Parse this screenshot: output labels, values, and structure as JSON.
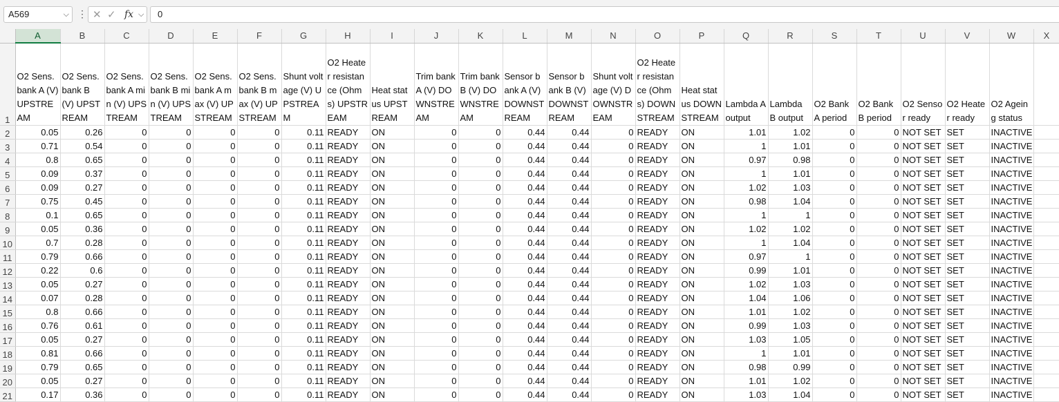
{
  "formula_bar": {
    "name_box": "A569",
    "chevron": "⌵",
    "more": "⋮",
    "cancel_icon": "✕",
    "enter_icon": "✓",
    "fx": "fx",
    "fx_chevron": "⌵",
    "value": "0"
  },
  "columns": [
    "A",
    "B",
    "C",
    "D",
    "E",
    "F",
    "G",
    "H",
    "I",
    "J",
    "K",
    "L",
    "M",
    "N",
    "O",
    "P",
    "Q",
    "R",
    "S",
    "T",
    "U",
    "V",
    "W",
    "X"
  ],
  "row_numbers": [
    1,
    2,
    3,
    4,
    5,
    6,
    7,
    8,
    9,
    10,
    11,
    12,
    13,
    14,
    15,
    16,
    17,
    18,
    19,
    20,
    21
  ],
  "header_row": [
    "O2 Sens.bank A (V) UPSTREAM",
    "O2 Sens.bank B (V) UPSTREAM",
    "O2 Sens.bank A min (V) UPSTREAM",
    "O2 Sens.bank B min (V) UPSTREAM",
    "O2 Sens.bank A max (V) UPSTREAM",
    "O2 Sens.bank B max (V) UPSTREAM",
    "Shunt voltage (V) UPSTREAM",
    "O2 Heater resistance (Ohms) UPSTREAM",
    "Heat status UPSTREAM",
    "Trim bank A (V) DOWNSTREAM",
    "Trim bank B (V) DOWNSTREAM",
    "Sensor bank A (V) DOWNSTREAM",
    "Sensor bank B (V) DOWNSTREAM",
    "Shunt voltage (V) DOWNSTREAM",
    "O2 Heater resistance (Ohms) DOWNSTREAM",
    "Heat status DOWNSTREAM",
    "Lambda A output",
    "Lambda B output",
    "O2 Bank A period",
    "O2 Bank B period",
    "O2 Sensor ready",
    "O2 Heater ready",
    "O2 Ageing status",
    ""
  ],
  "rows": [
    [
      "0.05",
      "0.26",
      "0",
      "0",
      "0",
      "0",
      "0.11",
      "READY",
      "ON",
      "0",
      "0",
      "0.44",
      "0.44",
      "0",
      "READY",
      "ON",
      "1.01",
      "1.02",
      "0",
      "0",
      "NOT SET",
      "SET",
      "INACTIVE",
      ""
    ],
    [
      "0.71",
      "0.54",
      "0",
      "0",
      "0",
      "0",
      "0.11",
      "READY",
      "ON",
      "0",
      "0",
      "0.44",
      "0.44",
      "0",
      "READY",
      "ON",
      "1",
      "1.01",
      "0",
      "0",
      "NOT SET",
      "SET",
      "INACTIVE",
      ""
    ],
    [
      "0.8",
      "0.65",
      "0",
      "0",
      "0",
      "0",
      "0.11",
      "READY",
      "ON",
      "0",
      "0",
      "0.44",
      "0.44",
      "0",
      "READY",
      "ON",
      "0.97",
      "0.98",
      "0",
      "0",
      "NOT SET",
      "SET",
      "INACTIVE",
      ""
    ],
    [
      "0.09",
      "0.37",
      "0",
      "0",
      "0",
      "0",
      "0.11",
      "READY",
      "ON",
      "0",
      "0",
      "0.44",
      "0.44",
      "0",
      "READY",
      "ON",
      "1",
      "1.01",
      "0",
      "0",
      "NOT SET",
      "SET",
      "INACTIVE",
      ""
    ],
    [
      "0.09",
      "0.27",
      "0",
      "0",
      "0",
      "0",
      "0.11",
      "READY",
      "ON",
      "0",
      "0",
      "0.44",
      "0.44",
      "0",
      "READY",
      "ON",
      "1.02",
      "1.03",
      "0",
      "0",
      "NOT SET",
      "SET",
      "INACTIVE",
      ""
    ],
    [
      "0.75",
      "0.45",
      "0",
      "0",
      "0",
      "0",
      "0.11",
      "READY",
      "ON",
      "0",
      "0",
      "0.44",
      "0.44",
      "0",
      "READY",
      "ON",
      "0.98",
      "1.04",
      "0",
      "0",
      "NOT SET",
      "SET",
      "INACTIVE",
      ""
    ],
    [
      "0.1",
      "0.65",
      "0",
      "0",
      "0",
      "0",
      "0.11",
      "READY",
      "ON",
      "0",
      "0",
      "0.44",
      "0.44",
      "0",
      "READY",
      "ON",
      "1",
      "1",
      "0",
      "0",
      "NOT SET",
      "SET",
      "INACTIVE",
      ""
    ],
    [
      "0.05",
      "0.36",
      "0",
      "0",
      "0",
      "0",
      "0.11",
      "READY",
      "ON",
      "0",
      "0",
      "0.44",
      "0.44",
      "0",
      "READY",
      "ON",
      "1.02",
      "1.02",
      "0",
      "0",
      "NOT SET",
      "SET",
      "INACTIVE",
      ""
    ],
    [
      "0.7",
      "0.28",
      "0",
      "0",
      "0",
      "0",
      "0.11",
      "READY",
      "ON",
      "0",
      "0",
      "0.44",
      "0.44",
      "0",
      "READY",
      "ON",
      "1",
      "1.04",
      "0",
      "0",
      "NOT SET",
      "SET",
      "INACTIVE",
      ""
    ],
    [
      "0.79",
      "0.66",
      "0",
      "0",
      "0",
      "0",
      "0.11",
      "READY",
      "ON",
      "0",
      "0",
      "0.44",
      "0.44",
      "0",
      "READY",
      "ON",
      "0.97",
      "1",
      "0",
      "0",
      "NOT SET",
      "SET",
      "INACTIVE",
      ""
    ],
    [
      "0.22",
      "0.6",
      "0",
      "0",
      "0",
      "0",
      "0.11",
      "READY",
      "ON",
      "0",
      "0",
      "0.44",
      "0.44",
      "0",
      "READY",
      "ON",
      "0.99",
      "1.01",
      "0",
      "0",
      "NOT SET",
      "SET",
      "INACTIVE",
      ""
    ],
    [
      "0.05",
      "0.27",
      "0",
      "0",
      "0",
      "0",
      "0.11",
      "READY",
      "ON",
      "0",
      "0",
      "0.44",
      "0.44",
      "0",
      "READY",
      "ON",
      "1.02",
      "1.03",
      "0",
      "0",
      "NOT SET",
      "SET",
      "INACTIVE",
      ""
    ],
    [
      "0.07",
      "0.28",
      "0",
      "0",
      "0",
      "0",
      "0.11",
      "READY",
      "ON",
      "0",
      "0",
      "0.44",
      "0.44",
      "0",
      "READY",
      "ON",
      "1.04",
      "1.06",
      "0",
      "0",
      "NOT SET",
      "SET",
      "INACTIVE",
      ""
    ],
    [
      "0.8",
      "0.66",
      "0",
      "0",
      "0",
      "0",
      "0.11",
      "READY",
      "ON",
      "0",
      "0",
      "0.44",
      "0.44",
      "0",
      "READY",
      "ON",
      "1.01",
      "1.02",
      "0",
      "0",
      "NOT SET",
      "SET",
      "INACTIVE",
      ""
    ],
    [
      "0.76",
      "0.61",
      "0",
      "0",
      "0",
      "0",
      "0.11",
      "READY",
      "ON",
      "0",
      "0",
      "0.44",
      "0.44",
      "0",
      "READY",
      "ON",
      "0.99",
      "1.03",
      "0",
      "0",
      "NOT SET",
      "SET",
      "INACTIVE",
      ""
    ],
    [
      "0.05",
      "0.27",
      "0",
      "0",
      "0",
      "0",
      "0.11",
      "READY",
      "ON",
      "0",
      "0",
      "0.44",
      "0.44",
      "0",
      "READY",
      "ON",
      "1.03",
      "1.05",
      "0",
      "0",
      "NOT SET",
      "SET",
      "INACTIVE",
      ""
    ],
    [
      "0.81",
      "0.66",
      "0",
      "0",
      "0",
      "0",
      "0.11",
      "READY",
      "ON",
      "0",
      "0",
      "0.44",
      "0.44",
      "0",
      "READY",
      "ON",
      "1",
      "1.01",
      "0",
      "0",
      "NOT SET",
      "SET",
      "INACTIVE",
      ""
    ],
    [
      "0.79",
      "0.65",
      "0",
      "0",
      "0",
      "0",
      "0.11",
      "READY",
      "ON",
      "0",
      "0",
      "0.44",
      "0.44",
      "0",
      "READY",
      "ON",
      "0.98",
      "0.99",
      "0",
      "0",
      "NOT SET",
      "SET",
      "INACTIVE",
      ""
    ],
    [
      "0.05",
      "0.27",
      "0",
      "0",
      "0",
      "0",
      "0.11",
      "READY",
      "ON",
      "0",
      "0",
      "0.44",
      "0.44",
      "0",
      "READY",
      "ON",
      "1.01",
      "1.02",
      "0",
      "0",
      "NOT SET",
      "SET",
      "INACTIVE",
      ""
    ],
    [
      "0.17",
      "0.36",
      "0",
      "0",
      "0",
      "0",
      "0.11",
      "READY",
      "ON",
      "0",
      "0",
      "0.44",
      "0.44",
      "0",
      "READY",
      "ON",
      "1.03",
      "1.04",
      "0",
      "0",
      "NOT SET",
      "SET",
      "INACTIVE",
      ""
    ]
  ],
  "selection": {
    "column": "A"
  }
}
